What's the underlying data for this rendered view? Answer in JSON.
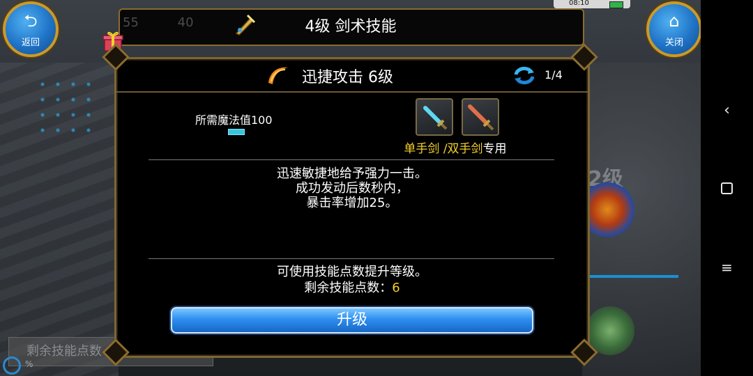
{
  "status_bar": {
    "time": "08:10"
  },
  "top_bar": {
    "back_label": "返回",
    "close_label": "关闭",
    "title": "4级 剑术技能",
    "bg_numbers": [
      "55",
      "40"
    ]
  },
  "dialog": {
    "skill_name": "迅捷攻击 6级",
    "page_indicator": "1/4",
    "mana_label": "所需魔法值100",
    "weapon_text_yellow": "单手剑 /双手剑",
    "weapon_text_white": "专用",
    "description": [
      "迅速敏捷地给予强力一击。",
      "成功发动后数秒内，",
      "暴击率增加25。"
    ],
    "info_line": "可使用技能点数提升等级。",
    "remaining_label": "剩余技能点数：",
    "remaining_value": "6",
    "upgrade_button": "升级"
  },
  "background": {
    "ghost_text": "2级",
    "bottom_label": "剩余技能点数",
    "percent": "%"
  },
  "icons": {
    "back": "back-arrow-icon",
    "close": "home-icon",
    "skill": "slash-icon",
    "refresh": "refresh-icon",
    "weapon_1": "one-hand-sword-icon",
    "weapon_2": "two-hand-sword-icon",
    "gift": "gift-icon"
  },
  "colors": {
    "accent_yellow": "#f4d02a",
    "button_blue": "#2e8ff0",
    "frame_gold": "#8a6d2e"
  }
}
